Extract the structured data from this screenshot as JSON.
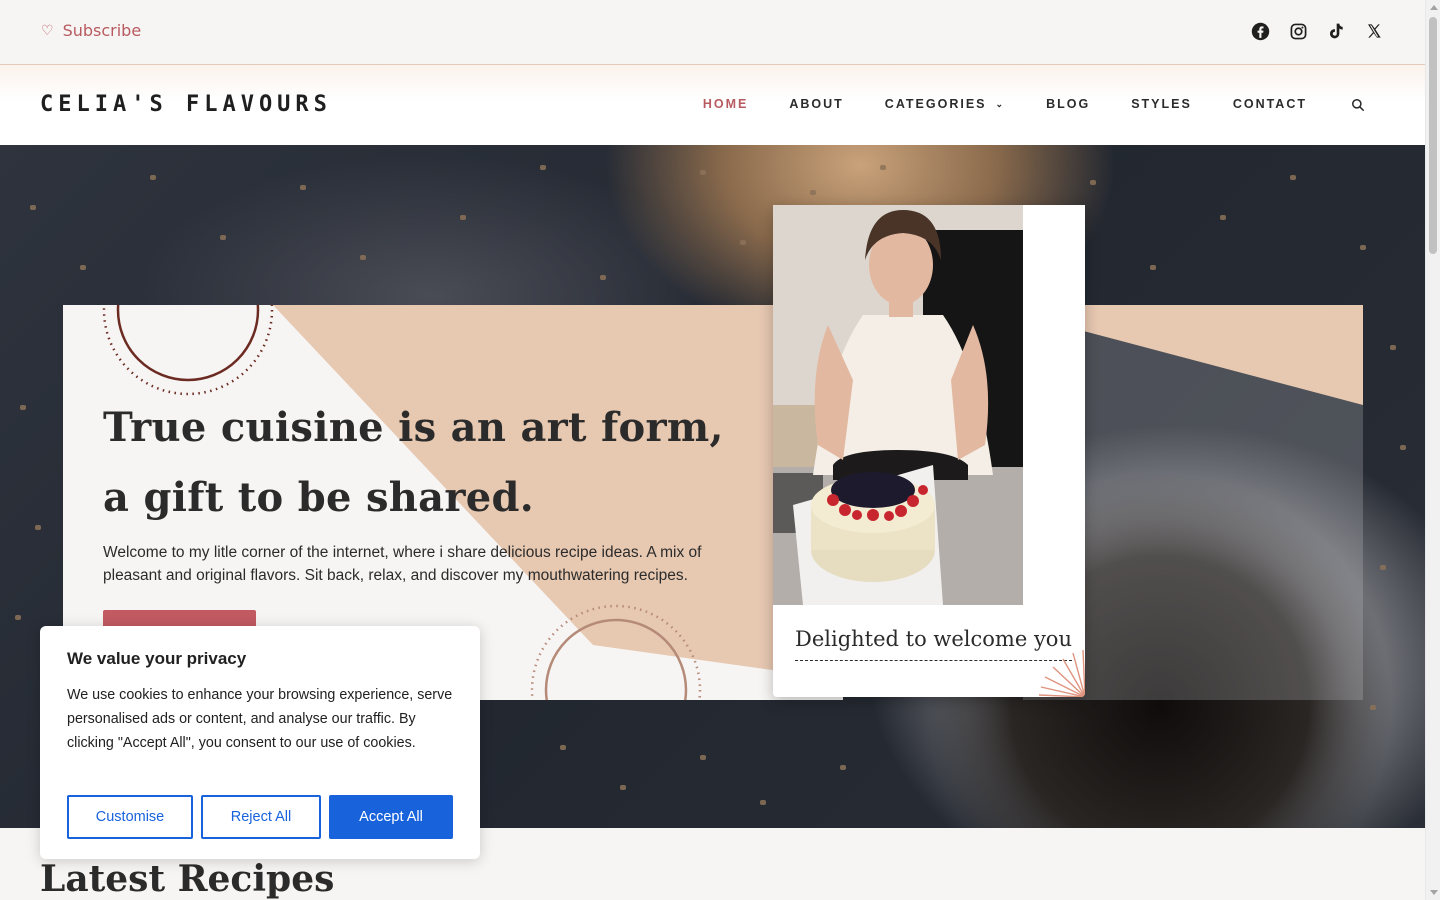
{
  "topbar": {
    "subscribe_label": "Subscribe",
    "subscribe_icon": "heart-icon",
    "socials": [
      "facebook-icon",
      "instagram-icon",
      "tiktok-icon",
      "x-icon"
    ]
  },
  "header": {
    "logo": "CELIA'S FLAVOURS",
    "nav": [
      {
        "label": "HOME",
        "active": true
      },
      {
        "label": "ABOUT"
      },
      {
        "label": "CATEGORIES",
        "has_dropdown": true
      },
      {
        "label": "BLOG"
      },
      {
        "label": "STYLES"
      },
      {
        "label": "CONTACT"
      }
    ],
    "search_icon": "search-icon"
  },
  "hero": {
    "headline_line1": "True cuisine is an art form,",
    "headline_line2": "a gift to be shared.",
    "intro": "Welcome to my litle corner of the internet, where i share delicious recipe ideas. A mix of pleasant and original flavors. Sit back, relax, and discover my mouthwatering recipes.",
    "photo_caption": "Delighted to welcome you"
  },
  "cookie_banner": {
    "title": "We value your privacy",
    "text": "We use cookies to enhance your browsing experience, serve personalised ads or content, and analyse our traffic. By clicking \"Accept All\", you consent to our use of cookies.",
    "buttons": {
      "customise": "Customise",
      "reject": "Reject All",
      "accept": "Accept All"
    }
  },
  "sections": {
    "latest_title": "Latest Recipes"
  },
  "colors": {
    "accent": "#b85b60",
    "peach": "#e7c8b1",
    "consent_blue": "#1863dc",
    "circle_brown": "#6b2a22"
  }
}
